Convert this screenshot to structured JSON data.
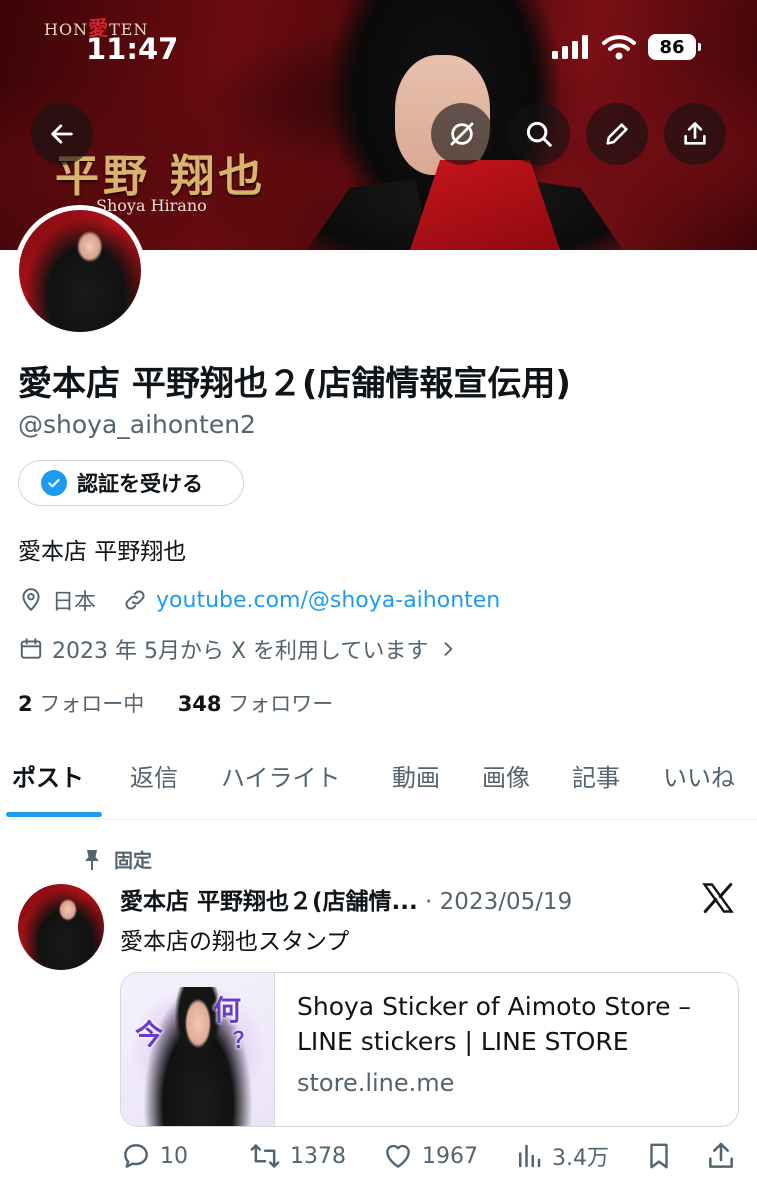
{
  "status_bar": {
    "time": "11:47",
    "battery": "86"
  },
  "banner": {
    "logo_left": "HON",
    "logo_mid": "愛",
    "logo_right": "TEN",
    "name_jp": "平野 翔也",
    "name_en": "Shoya Hirano",
    "colors": {
      "base": "#6b0c10",
      "accent_gold": "#d6b46e"
    }
  },
  "top_actions": {
    "back": "arrow-left-icon",
    "grok": "grok-icon",
    "search": "search-icon",
    "edit": "pencil-icon",
    "share": "share-icon"
  },
  "profile": {
    "display_name": "愛本店 平野翔也２(店舗情報宣伝用)",
    "handle": "@shoya_aihonten2",
    "verify_label": "認証を受ける",
    "bio": "愛本店 平野翔也",
    "location": "日本",
    "website": "youtube.com/@shoya-aihonten",
    "joined": "2023 年 5月から X を利用しています",
    "following_count": "2",
    "following_label": "フォロー中",
    "followers_count": "348",
    "followers_label": "フォロワー"
  },
  "tabs": [
    "ポスト",
    "返信",
    "ハイライト",
    "動画",
    "画像",
    "記事",
    "いいね"
  ],
  "post": {
    "pinned_label": "固定",
    "author": "愛本店 平野翔也２(店舗情...",
    "date": "2023/05/19",
    "text": "愛本店の翔也スタンプ",
    "card": {
      "title": "Shoya Sticker of Aimoto Store – LINE stickers | LINE STORE",
      "domain": "store.line.me",
      "thumb_text_1": "今",
      "thumb_text_2": "何",
      "thumb_text_3": "？"
    },
    "replies": "10",
    "reposts": "1378",
    "likes": "1967",
    "views": "3.4万"
  },
  "colors": {
    "accent_blue": "#1d9bf0",
    "secondary_text": "#536471",
    "primary_text": "#0f1419",
    "border": "#cfd9de"
  }
}
